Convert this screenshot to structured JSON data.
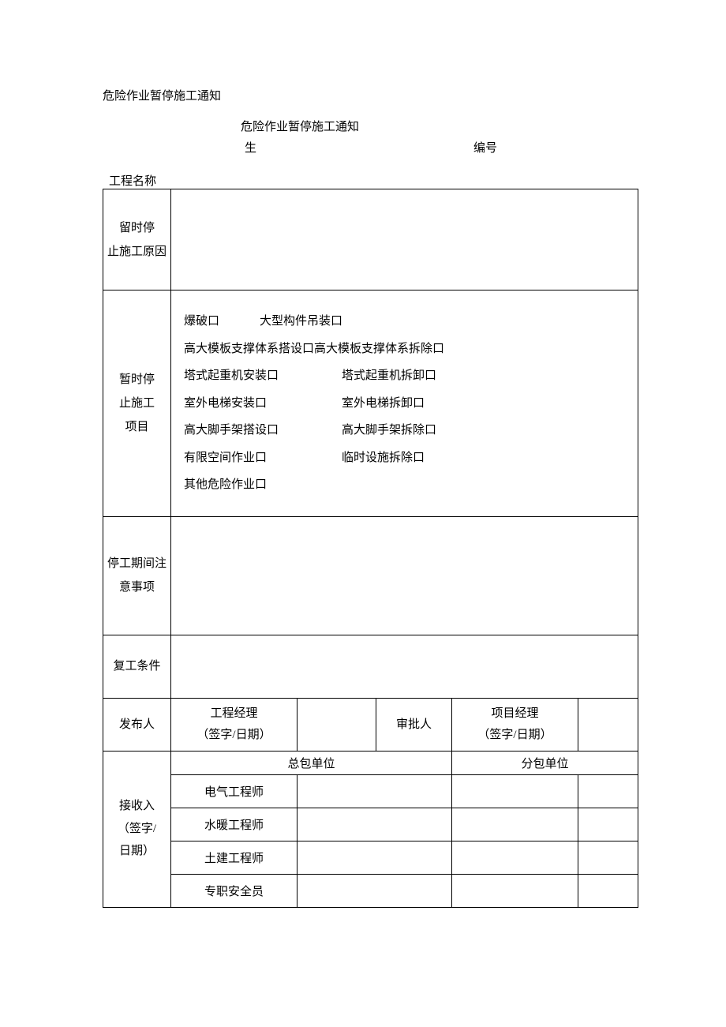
{
  "header": {
    "top_title": "危险作业暂停施工通知",
    "main_title": "危险作业暂停施工通知",
    "sheng": "生",
    "bianhao": "编号"
  },
  "labels": {
    "project_name": "工程名称",
    "temp_stop_reason_l1": "留时停",
    "temp_stop_reason_l2": "止施工原因",
    "temp_stop_items_l1": "暂时停",
    "temp_stop_items_l2": "止施工",
    "temp_stop_items_l3": "项目",
    "stop_notes_l1": "停工期间注",
    "stop_notes_l2": "意事项",
    "resume_cond": "复工条件",
    "publisher": "发布人",
    "approver": "审批人",
    "recv_l1": "接收入",
    "recv_l2": "（签字/",
    "recv_l3": "日期）"
  },
  "checkboxes": {
    "r1a": "爆破口",
    "r1b": "大型构件吊装口",
    "r2": "高大模板支撑体系搭设口高大模板支撑体系拆除口",
    "r3a": "塔式起重机安装口",
    "r3b": "塔式起重机拆卸口",
    "r4a": "室外电梯安装口",
    "r4b": "室外电梯拆卸口",
    "r5a": "高大脚手架搭设口",
    "r5b": "高大脚手架拆除口",
    "r6a": "有限空间作业口",
    "r6b": "临时设施拆除口",
    "r7": "其他危险作业口"
  },
  "sign": {
    "pm_engineer_l1": "工程经理",
    "pm_engineer_l2": "（签字/日期）",
    "proj_mgr_l1": "项目经理",
    "proj_mgr_l2": "（签字/日期）",
    "zongbao": "总包单位",
    "fenbao": "分包单位",
    "elec": "电气工程师",
    "plumb": "水暖工程师",
    "civil": "土建工程师",
    "safety": "专职安全员"
  }
}
